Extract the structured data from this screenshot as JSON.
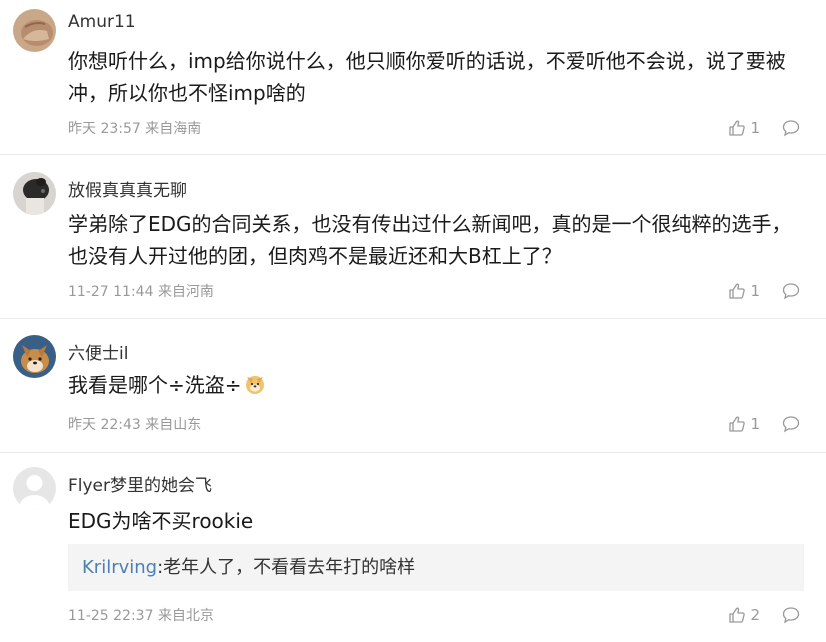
{
  "comments": [
    {
      "username": "Amur11",
      "text": "你想听什么，imp给你说什么，他只顺你爱听的话说，不爱听他不会说，说了要被冲，所以你也不怪imp啥的",
      "time": "昨天 23:57",
      "location": "来自海南",
      "likes": "1",
      "avatar": "hand-photo"
    },
    {
      "username": "放假真真真无聊",
      "text": "学弟除了EDG的合同关系，也没有传出过什么新闻吧，真的是一个很纯粹的选手，也没有人开过他的团，但肉鸡不是最近还和大B杠上了？",
      "time": "11-27 11:44",
      "location": "来自河南",
      "likes": "1",
      "avatar": "dark-animal-photo"
    },
    {
      "username": "六便士il",
      "text": "我看是哪个÷洗盗÷",
      "emoji": "doge-emoji",
      "time": "昨天 22:43",
      "location": "来自山东",
      "likes": "1",
      "avatar": "shiba-dog-photo"
    },
    {
      "username": "Flyer梦里的她会飞",
      "text": "EDG为啥不买rookie",
      "reply": {
        "user": "Krilrving",
        "separator": ":",
        "text": "老年人了，不看看去年打的啥样"
      },
      "time": "11-25 22:37",
      "location": "来自北京",
      "likes": "2",
      "avatar": "default-avatar"
    }
  ],
  "colors": {
    "username": "#333333",
    "meta": "#999999",
    "reply_user": "#4a7fb5",
    "reply_bg": "#f4f4f4",
    "divider": "#e9e9e9"
  },
  "icons": [
    "thumbs-up-icon",
    "comment-bubble-icon"
  ]
}
